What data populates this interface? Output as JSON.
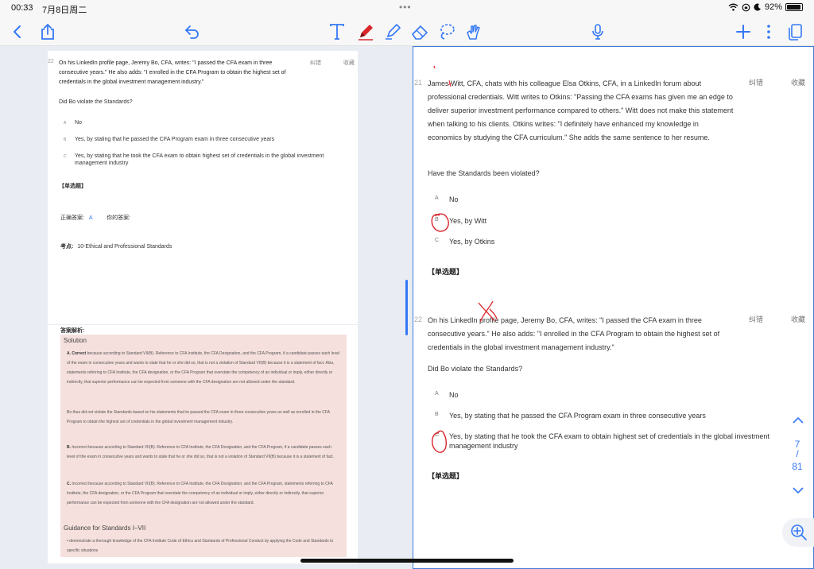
{
  "status": {
    "time": "00:33",
    "date": "7月8日周二",
    "battery": "92%"
  },
  "toolbar": {
    "left_icons": [
      "back-chevron-icon",
      "share-icon",
      "undo-icon"
    ],
    "center_icons": [
      "text-tool-icon",
      "pen-icon",
      "highlighter-icon",
      "eraser-icon",
      "lasso-icon",
      "finger-draw-icon"
    ],
    "right_icons": [
      "microphone-icon",
      "plus-icon",
      "more-icon",
      "pages-icon"
    ]
  },
  "left": {
    "q22": {
      "num": "22",
      "text": "On his LinkedIn profile page, Jeremy Bo, CFA, writes: \"I passed the CFA exam in three consecutive years.\" He also adds: \"I enrolled in the CFA Program to obtain the highest set of credentials in the global investment management industry.\"",
      "act1": "纠错",
      "act2": "收藏",
      "ask": "Did Bo violate the Standards?",
      "options": [
        {
          "letter": "A",
          "text": "No"
        },
        {
          "letter": "B",
          "text": "Yes, by stating that he passed the CFA Program exam in three consecutive years"
        },
        {
          "letter": "C",
          "text": "Yes, by stating that he took the CFA exam to obtain highest set of credentials in the global investment management industry"
        }
      ],
      "tag": "【单选题】",
      "correct_label": "正确答案:",
      "correct_value": "A",
      "your_label": "你的答案:",
      "topic_label": "考点:",
      "topic_value": "10-Ethical and Professional Standards"
    },
    "analysis": {
      "label": "答案解析:",
      "solution_heading": "Solution",
      "para_a_lead": "A. Correct",
      "para_a": "because according to Standard VII(B). Reference to CFA Institute, the CFA Designation, and the CFA Program, if a candidate passes each level of the exam in consecutive years and wants to state that he or she did so, that is not a violation of Standard VII(B) because it is a statement of fact. Also, statements referring to CFA Institute, the CFA designation, or the CFA Program that overstate the competency of an individual or imply, either directly or indirectly, that superior performance can be expected from someone with the CFA designation are not allowed under the standard.",
      "para_a2": "Bo thus did not violate the Standards based on his statements that he passed the CFA exam in three consecutive years as well as enrolled in the CFA Program to obtain the highest set of credentials in the global investment management industry.",
      "para_b_lead": "B.",
      "para_b": "Incorrect because according to Standard VII(B). Reference to CFA Institute, the CFA Designation, and the CFA Program, if a candidate passes each level of the exam in consecutive years and wants to state that he or she did so, that is not a violation of Standard VII(B) because it is a statement of fact.",
      "para_c_lead": "C.",
      "para_c": "Incorrect because according to Standard VII(B). Reference to CFA Institute, the CFA Designation, and the CFA Program, statements referring to CFA Institute, the CFA designation, or the CFA Program that overstate the competency of an individual or imply, either directly or indirectly, that superior performance can be expected from someone with the CFA designation are not allowed under the standard.",
      "guidance_heading": "Guidance for Standards I–VII",
      "guidance_bullet": "demonstrate a thorough knowledge of the CFA Institute Code of Ethics and Standards of Professional Conduct by applying the Code and Standards to specific situations"
    }
  },
  "right": {
    "q21": {
      "num": "21",
      "text": "James Witt, CFA, chats with his colleague Elsa Otkins, CFA, in a LinkedIn forum about professional credentials. Witt writes to Otkins: \"Passing the CFA exams has given me an edge to deliver superior investment performance compared to others.\" Witt does not make this statement when talking to his clients. Otkins writes: \"I definitely have enhanced my knowledge in economics by studying the CFA curriculum.\" She adds the same sentence to her resume.",
      "act1": "纠错",
      "act2": "收藏",
      "ask": "Have the Standards been violated?",
      "options": [
        {
          "letter": "A",
          "text": "No"
        },
        {
          "letter": "B",
          "text": "Yes, by Witt"
        },
        {
          "letter": "C",
          "text": "Yes, by Otkins"
        }
      ],
      "tag": "【单选题】"
    },
    "q22": {
      "num": "22",
      "text": "On his LinkedIn profile page, Jeremy Bo, CFA, writes: \"I passed the CFA exam in three consecutive years.\" He also adds: \"I enrolled in the CFA Program to obtain the highest set of credentials in the global investment management industry.\"",
      "act1": "纠错",
      "act2": "收藏",
      "ask": "Did Bo violate the Standards?",
      "options": [
        {
          "letter": "A",
          "text": "No"
        },
        {
          "letter": "B",
          "text": "Yes, by stating that he passed the CFA Program exam in three consecutive years"
        },
        {
          "letter": "C",
          "text": "Yes, by stating that he took the CFA exam to obtain highest set of credentials in the global investment management industry"
        }
      ],
      "tag": "【单选题】"
    },
    "pager": {
      "current": "7",
      "slash": "/",
      "total": "81"
    }
  },
  "colors": {
    "accent": "#3478f6",
    "ink_red": "#d9262c",
    "solution_bg": "#f5e0dd"
  }
}
